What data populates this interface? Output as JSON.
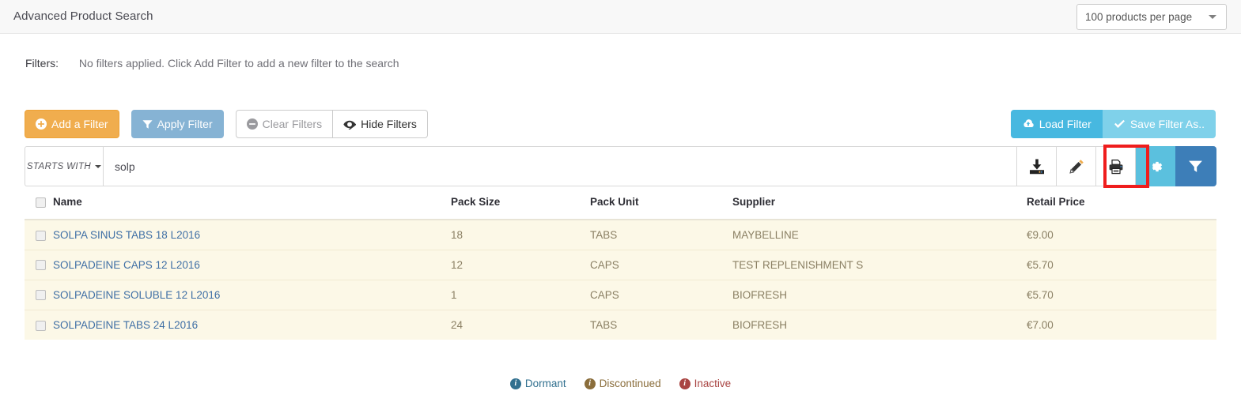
{
  "topbar": {
    "title": "Advanced Product Search",
    "per_page_value": "100 products per page",
    "caret_icon": "chevron-down-icon"
  },
  "filters": {
    "label": "Filters:",
    "message": "No filters applied. Click Add Filter to add a new filter to the search",
    "buttons": {
      "add_filter": "Add a Filter",
      "apply_filter": "Apply Filter",
      "clear_filters": "Clear Filters",
      "hide_filters": "Hide Filters",
      "load_filter": "Load Filter",
      "save_filter_as": "Save Filter As.."
    },
    "icons": {
      "add": "plus-circle-icon",
      "apply": "funnel-icon",
      "clear": "minus-circle-icon",
      "hide": "eye-slash-icon",
      "load": "cloud-upload-icon",
      "save": "check-icon"
    },
    "colors": {
      "add_filter_bg": "#f0ad4e",
      "apply_filter_bg": "#86b3d4",
      "load_filter_bg": "#47b8e0",
      "save_filter_bg": "#7fd1ea"
    }
  },
  "search": {
    "mode_label": "STARTS WITH",
    "query_value": "solp",
    "placeholder": "",
    "actions": [
      {
        "name": "export-icon",
        "label": "Export"
      },
      {
        "name": "edit-icon",
        "label": "Edit"
      },
      {
        "name": "print-icon",
        "label": "Print"
      },
      {
        "name": "gear-icon",
        "label": "Settings"
      },
      {
        "name": "funnel-icon",
        "label": "Filter"
      }
    ],
    "highlight": {
      "target": "print-icon",
      "color": "#ef1d1d"
    }
  },
  "table": {
    "select_all_checkbox": "unchecked",
    "columns": [
      "Name",
      "Pack Size",
      "Pack Unit",
      "Supplier",
      "Retail Price"
    ],
    "rows": [
      {
        "name": "SOLPA SINUS TABS 18 L2016",
        "pack_size": "18",
        "pack_unit": "TABS",
        "supplier": "MAYBELLINE",
        "retail_price": "€9.00"
      },
      {
        "name": "SOLPADEINE CAPS 12 L2016",
        "pack_size": "12",
        "pack_unit": "CAPS",
        "supplier": "TEST REPLENISHMENT S",
        "retail_price": "€5.70"
      },
      {
        "name": "SOLPADEINE SOLUBLE 12 L2016",
        "pack_size": "1",
        "pack_unit": "CAPS",
        "supplier": "BIOFRESH",
        "retail_price": "€5.70"
      },
      {
        "name": "SOLPADEINE TABS 24 L2016",
        "pack_size": "24",
        "pack_unit": "TABS",
        "supplier": "BIOFRESH",
        "retail_price": "€7.00"
      }
    ],
    "row_bg": "#fcf8e7",
    "link_color": "#3f6fa5"
  },
  "legend": [
    {
      "label": "Dormant",
      "color": "#31708f",
      "icon": "info-circle-icon"
    },
    {
      "label": "Discontinued",
      "color": "#8a6d3b",
      "icon": "info-circle-icon"
    },
    {
      "label": "Inactive",
      "color": "#a94442",
      "icon": "info-circle-icon"
    }
  ]
}
